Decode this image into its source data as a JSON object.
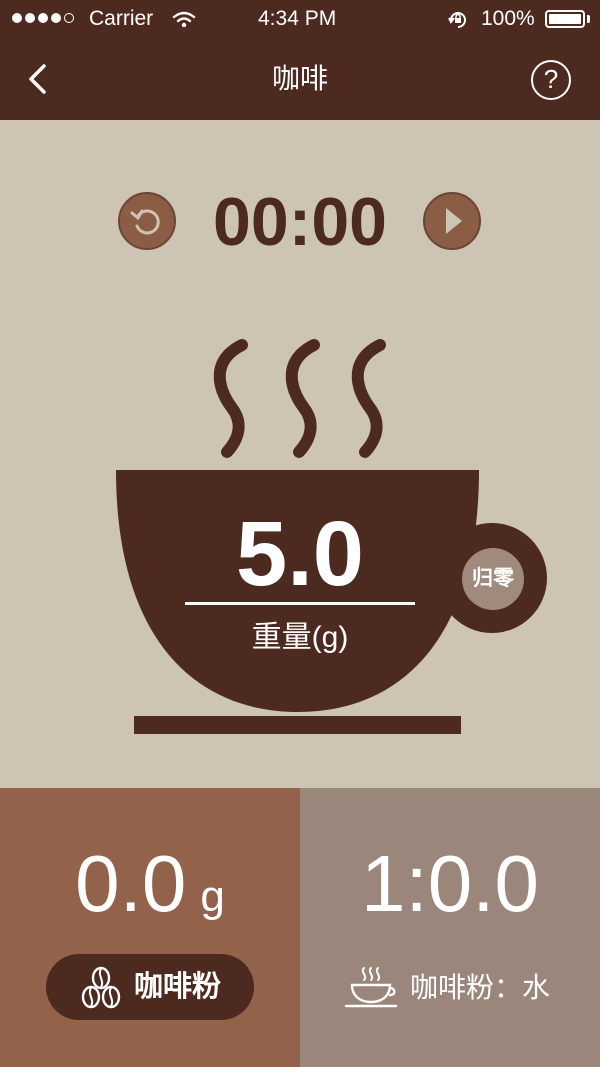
{
  "status_bar": {
    "carrier": "Carrier",
    "time": "4:34 PM",
    "battery": "100%"
  },
  "nav": {
    "title": "咖啡",
    "back_icon": "chevron-left-icon",
    "help_label": "?"
  },
  "timer": {
    "value": "00:00",
    "reset_icon": "reset-icon",
    "play_icon": "play-icon"
  },
  "scale": {
    "weight": "5.0",
    "label": "重量(g)",
    "zero_button": "归零"
  },
  "panels": {
    "powder": {
      "amount": "0.0",
      "unit": "g",
      "button_label": "咖啡粉",
      "icon": "coffee-beans-icon"
    },
    "ratio": {
      "value": "1:0.0",
      "caption": "咖啡粉：水",
      "icon": "coffee-cup-icon"
    }
  },
  "colors": {
    "header": "#4d2a20",
    "background": "#cdc4b3",
    "cup": "#4d2a20",
    "panel_left": "#93624a",
    "panel_right": "#9b867b",
    "button_circle": "#8a5d44",
    "zero_button": "#a08a7e"
  }
}
